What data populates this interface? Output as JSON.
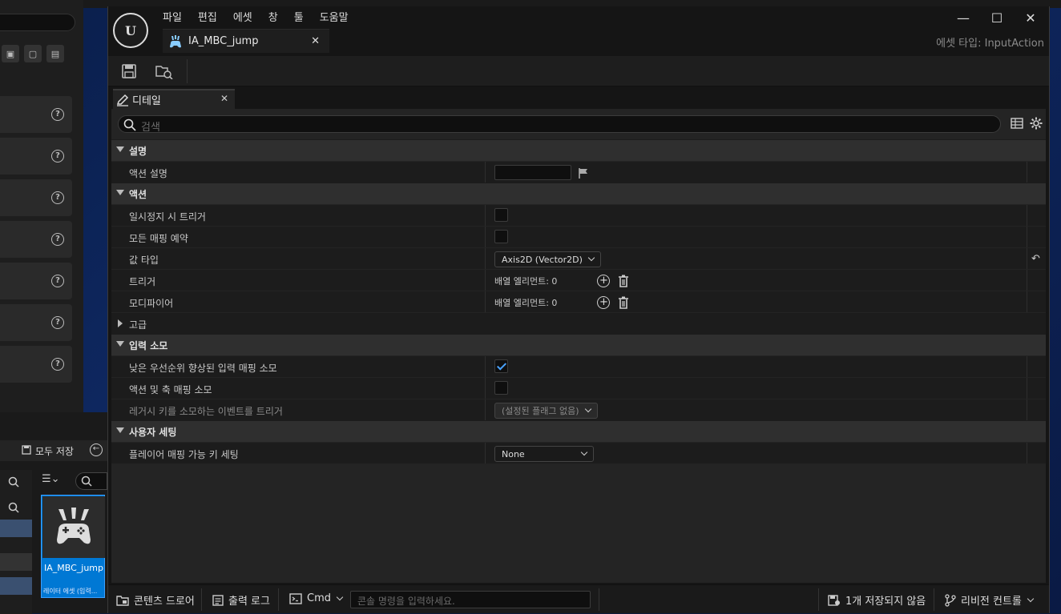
{
  "bg": {
    "save_all": "모두 저장",
    "asset_name": "IA_MBC_jump",
    "asset_type": "레이터 에셋 (입력..."
  },
  "window": {
    "logo": "U",
    "menu": [
      "파일",
      "편집",
      "에셋",
      "창",
      "툴",
      "도움말"
    ],
    "tab_label": "IA_MBC_jump",
    "asset_type_label": "에셋 타입: InputAction"
  },
  "details": {
    "tab_label": "디테일",
    "search_placeholder": "검색",
    "categories": {
      "description": "설명",
      "action": "액션",
      "advanced": "고급",
      "input_consumption": "입력 소모",
      "user_settings": "사용자 세팅"
    },
    "props": {
      "action_description": "액션 설명",
      "trigger_when_paused": "일시정지 시 트리거",
      "reserve_all_mappings": "모든 매핑 예약",
      "value_type": "값 타입",
      "value_type_value": "Axis2D (Vector2D)",
      "triggers": "트리거",
      "triggers_value": "배열 엘리먼트: 0",
      "modifiers": "모디파이어",
      "modifiers_value": "배열 엘리먼트: 0",
      "consume_lower_priority": "낮은 우선순위 향상된 입력 매핑 소모",
      "consume_action_axis": "액션 및 축 매핑 소모",
      "trigger_legacy_events": "레거시 키를 소모하는 이벤트를 트리거",
      "legacy_flags_value": "(설정된 플래그 없음)",
      "player_mappable_settings": "플레이어 매핑 가능 키 세팅",
      "player_mappable_value": "None"
    },
    "checks": {
      "trigger_when_paused": false,
      "reserve_all_mappings": false,
      "consume_lower_priority": true,
      "consume_action_axis": false
    }
  },
  "statusbar": {
    "content_drawer": "콘텐츠 드로어",
    "output_log": "출력 로그",
    "cmd": "Cmd",
    "cmd_placeholder": "콘솔 명령을 입력하세요.",
    "unsaved": "1개 저장되지 않음",
    "revision_control": "리비전 컨트롤"
  }
}
